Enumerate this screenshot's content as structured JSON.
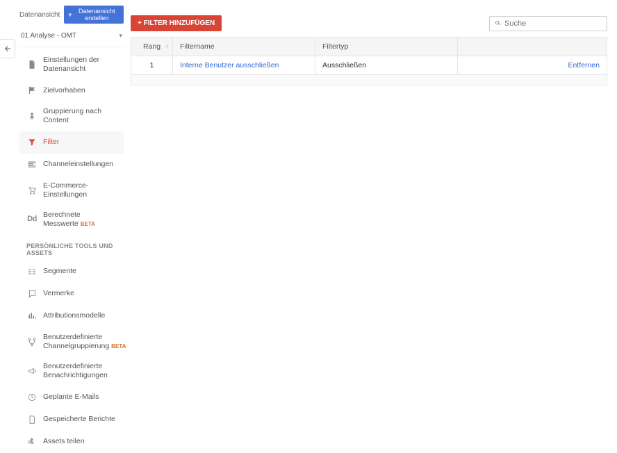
{
  "top": {
    "label": "Datenansicht",
    "create_btn": "Datenansicht erstellen"
  },
  "selector": {
    "value": "01 Analyse - OMT"
  },
  "nav": {
    "items": [
      {
        "label": "Einstellungen der Datenansicht"
      },
      {
        "label": "Zielvorhaben"
      },
      {
        "label": "Gruppierung nach Content"
      },
      {
        "label": "Filter"
      },
      {
        "label": "Channeleinstellungen"
      },
      {
        "label": "E-Commerce-Einstellungen"
      },
      {
        "label": "Berechnete Messwerte",
        "beta": "BETA"
      }
    ],
    "section": "PERSÖNLICHE TOOLS UND ASSETS",
    "items2": [
      {
        "label": "Segmente"
      },
      {
        "label": "Vermerke"
      },
      {
        "label": "Attributionsmodelle"
      },
      {
        "label": "Benutzerdefinierte Channelgruppierung",
        "beta": "BETA"
      },
      {
        "label": "Benutzerdefinierte Benachrichtigungen"
      },
      {
        "label": "Geplante E-Mails"
      },
      {
        "label": "Gespeicherte Berichte"
      },
      {
        "label": "Assets teilen"
      }
    ]
  },
  "toolbar": {
    "add_filter": "+ FILTER HINZUFÜGEN",
    "search_placeholder": "Suche"
  },
  "table": {
    "headers": {
      "rank": "Rang",
      "name": "Filtername",
      "type": "Filtertyp"
    },
    "rows": [
      {
        "rank": "1",
        "name": "Interne Benutzer ausschließen",
        "type": "Ausschließen",
        "action": "Entfernen"
      }
    ]
  }
}
